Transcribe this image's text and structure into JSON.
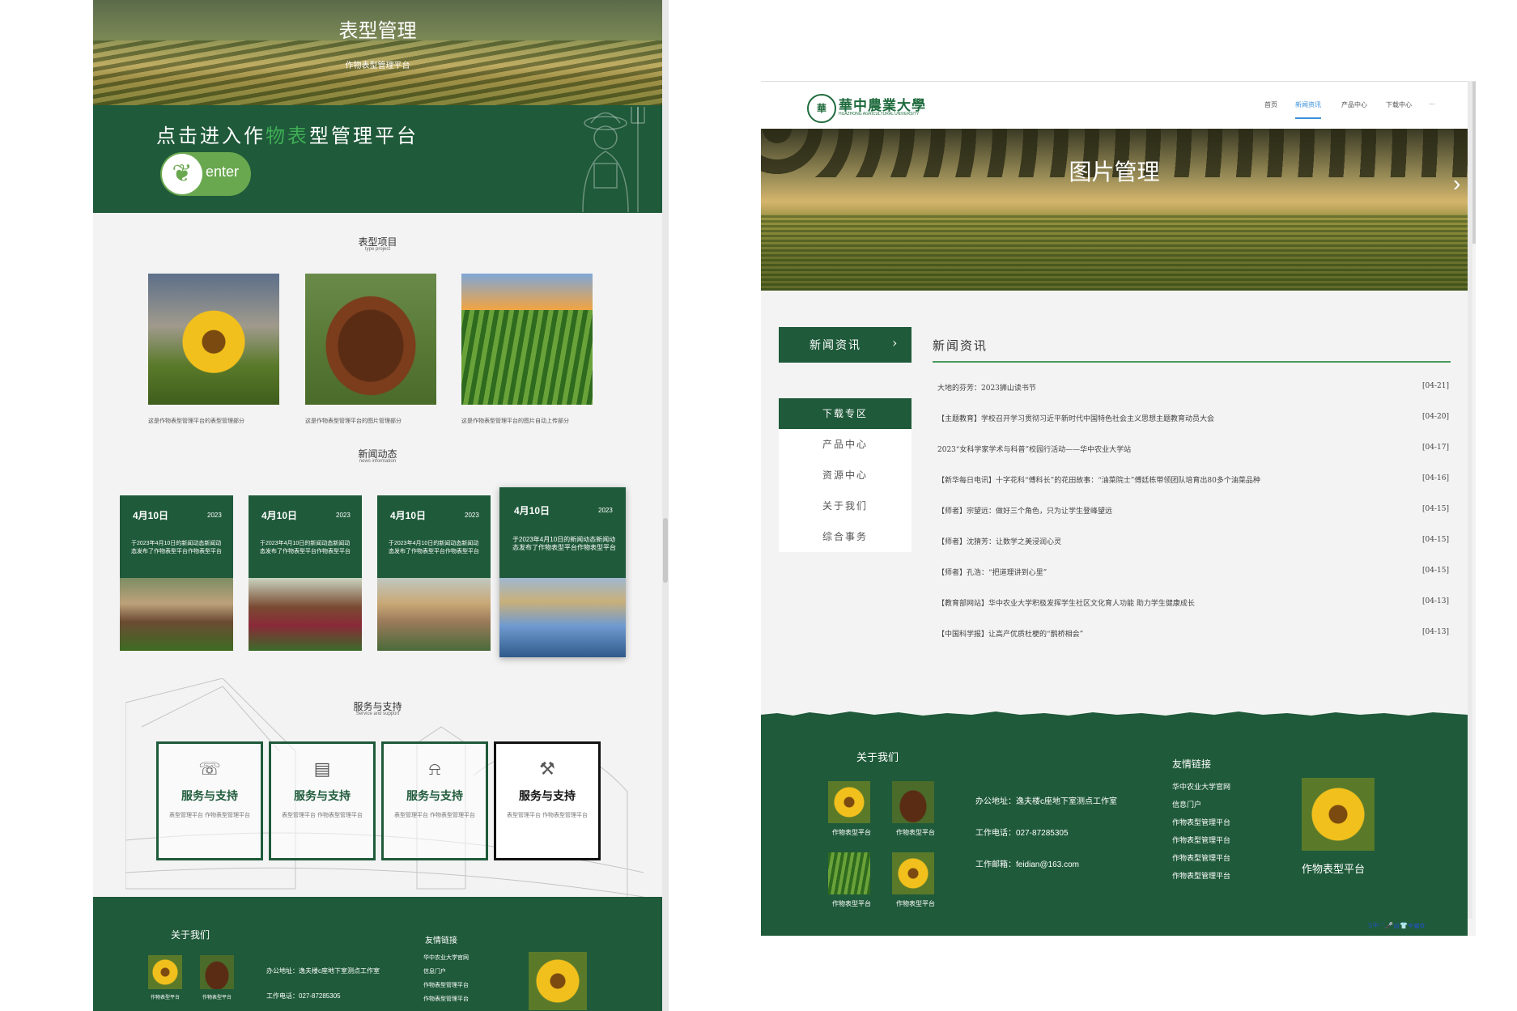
{
  "left_page": {
    "hero": {
      "title": "表型管理",
      "subtitle": "作物表型管理平台"
    },
    "enter": {
      "headline_part1": "点击进入作",
      "headline_green": "物表",
      "headline_part2": "型管理平台",
      "button_label": "enter"
    },
    "projects": {
      "title": "表型项目",
      "subtitle": "type project",
      "items": [
        {
          "image": "sunflower",
          "caption": "这是作物表型管理平台的表型管理部分"
        },
        {
          "image": "cow",
          "caption": "这是作物表型管理平台的图片管理部分"
        },
        {
          "image": "corn-field",
          "caption": "这是作物表型管理平台的图片自动上传部分"
        }
      ]
    },
    "news": {
      "title": "新闻动态",
      "subtitle": "news information",
      "cards": [
        {
          "date": "4月10日",
          "year": "2023",
          "text": "于2023年4月10日的新闻动态新闻动态发布了作物表型平台作物表型平台"
        },
        {
          "date": "4月10日",
          "year": "2023",
          "text": "于2023年4月10日的新闻动态新闻动态发布了作物表型平台作物表型平台"
        },
        {
          "date": "4月10日",
          "year": "2023",
          "text": "于2023年4月10日的新闻动态新闻动态发布了作物表型平台作物表型平台"
        },
        {
          "date": "4月10日",
          "year": "2023",
          "text": "于2023年4月10日的新闻动态新闻动态发布了作物表型平台作物表型平台"
        }
      ]
    },
    "services": {
      "title": "服务与支持",
      "subtitle": "Service and support",
      "items": [
        {
          "icon": "phone-icon",
          "label": "服务与支持",
          "desc": "表型管理平台 作物表型管理平台"
        },
        {
          "icon": "server-icon",
          "label": "服务与支持",
          "desc": "表型管理平台 作物表型管理平台"
        },
        {
          "icon": "bell-icon",
          "label": "服务与支持",
          "desc": "表型管理平台 作物表型管理平台"
        },
        {
          "icon": "tools-icon",
          "label": "服务与支持",
          "desc": "表型管理平台 作物表型管理平台"
        }
      ]
    },
    "footer": {
      "about_title": "关于我们",
      "thumb_caption": "作物表型平台",
      "address": "办公地址：逸夫楼c座地下室测点工作室",
      "phone": "工作电话：027-87285305",
      "links_title": "友情链接",
      "links": [
        "华中农业大学官网",
        "信息门户",
        "作物表型管理平台",
        "作物表型管理平台"
      ]
    }
  },
  "right_page": {
    "logo": {
      "name": "華中農業大學",
      "en": "HUAZHONG AGRICULTURAL UNIVERSITY"
    },
    "nav": [
      "首页",
      "新闻资讯",
      "产品中心",
      "下载中心",
      "···"
    ],
    "nav_active": 1,
    "banner": {
      "title": "图片管理"
    },
    "sidebar": {
      "header": "新闻资讯",
      "items": [
        "下载专区",
        "产品中心",
        "资源中心",
        "关于我们",
        "综合事务"
      ]
    },
    "news": {
      "heading": "新闻资讯",
      "items": [
        {
          "title": "大地的芬芳：2023狮山读书节",
          "date": "[04-21]"
        },
        {
          "title": "【主题教育】学校召开学习贯彻习近平新时代中国特色社会主义思想主题教育动员大会",
          "date": "[04-20]"
        },
        {
          "title": "2023“女科学家学术与科普”校园行活动——华中农业大学站",
          "date": "[04-17]"
        },
        {
          "title": "【新华每日电讯】十字花科“傅科长”的花田故事：“油菜院士”傅廷栋带领团队培育出80多个油菜品种",
          "date": "[04-16]"
        },
        {
          "title": "【师者】宗望远：做好三个角色，只为让学生登峰望远",
          "date": "[04-15]"
        },
        {
          "title": "【师者】沈猜芳：让数学之美浸润心灵",
          "date": "[04-15]"
        },
        {
          "title": "【师者】孔浩：“把道理讲到心里”",
          "date": "[04-15]"
        },
        {
          "title": "【教育部网站】华中农业大学积极发挥学生社区文化育人功能 助力学生健康成长",
          "date": "[04-13]"
        },
        {
          "title": "【中国科学报】让高产优质杜梗的“鹊桥相会”",
          "date": "[04-13]"
        }
      ]
    },
    "footer": {
      "about_title": "关于我们",
      "thumb_caption": "作物表型平台",
      "address": "办公地址：逸夫楼c座地下室测点工作室",
      "phone": "工作电话：027-87285305",
      "email": "工作邮箱：feidian@163.com",
      "links_title": "友情链接",
      "links": [
        "华中农业大学官网",
        "信息门户",
        "作物表型管理平台",
        "作物表型管理平台",
        "作物表型管理平台",
        "作物表型管理平台"
      ],
      "brand_caption": "作物表型平台"
    },
    "tray": "S中·°,🎤▤👕❖▦✿"
  },
  "colors": {
    "brand_green": "#1f5a3a",
    "accent_green": "#6aa84f",
    "link_blue": "#3a8fd9"
  }
}
